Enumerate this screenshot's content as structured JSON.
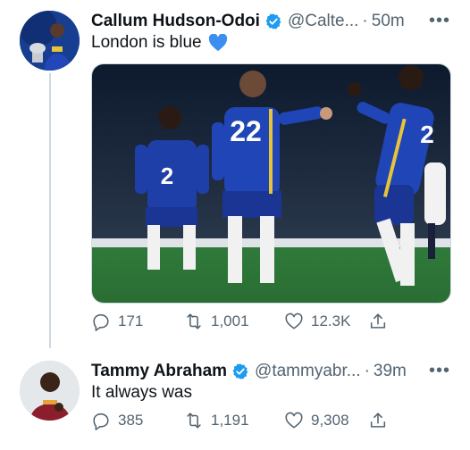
{
  "tweets": [
    {
      "author": "Callum Hudson-Odoi",
      "handle": "@Calte...",
      "separator": "·",
      "time": "50m",
      "more_icon": "more-icon",
      "text": "London is blue",
      "emoji": "blue-heart-icon",
      "has_photo": true,
      "replies": "171",
      "retweets": "1,001",
      "likes": "12.3K",
      "jersey_numbers": [
        "2",
        "22",
        "2"
      ]
    },
    {
      "author": "Tammy Abraham",
      "handle": "@tammyabr...",
      "separator": "·",
      "time": "39m",
      "more_icon": "more-icon",
      "text": "It always was",
      "has_photo": false,
      "replies": "385",
      "retweets": "1,191",
      "likes": "9,308"
    }
  ],
  "colors": {
    "verified": "#1d9bf0",
    "secondary_text": "#536471",
    "thread_line": "#cfd9de",
    "chelsea_blue": "#1f3fa8",
    "pitch_green": "#2f7a3a"
  }
}
